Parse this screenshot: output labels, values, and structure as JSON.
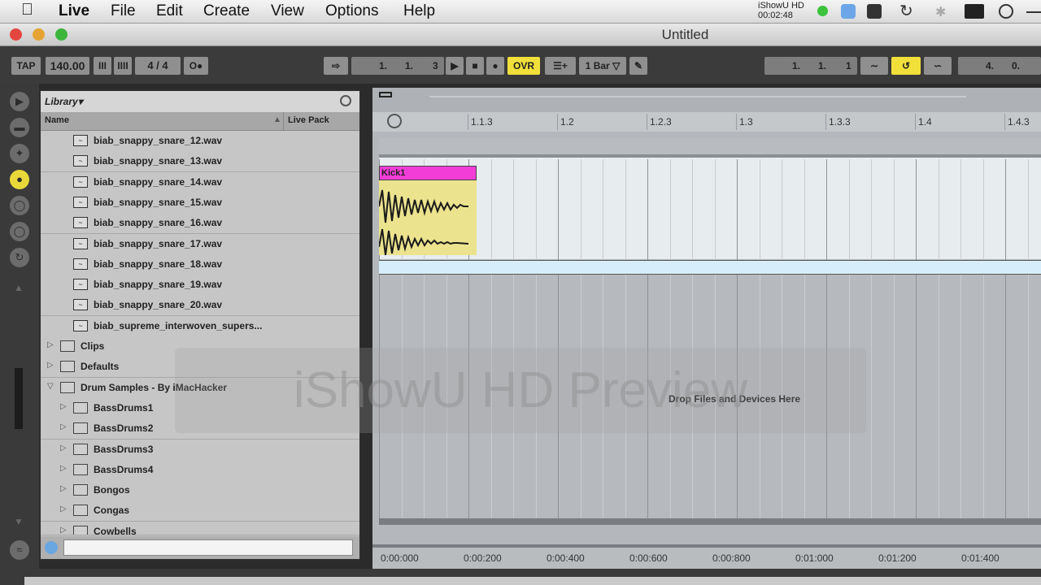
{
  "menubar": {
    "app": "Live",
    "items": [
      "File",
      "Edit",
      "Create",
      "View",
      "Options",
      "Help"
    ],
    "recorder_name": "iShowU HD",
    "recorder_time": "00:02:48"
  },
  "window": {
    "title": "Untitled"
  },
  "transport": {
    "tap": "TAP",
    "tempo": "140.00",
    "time_sig": "4 / 4",
    "position": [
      "1.",
      "1.",
      "3"
    ],
    "ovr": "OVR",
    "quantize": "1 Bar",
    "loop_start": [
      "1.",
      "1.",
      "1"
    ],
    "loop_length": [
      "4.",
      "0."
    ]
  },
  "browser": {
    "title": "Library",
    "col_name": "Name",
    "col_pack": "Live Pack",
    "files": [
      "biab_snappy_snare_12.wav",
      "biab_snappy_snare_13.wav",
      "biab_snappy_snare_14.wav",
      "biab_snappy_snare_15.wav",
      "biab_snappy_snare_16.wav",
      "biab_snappy_snare_17.wav",
      "biab_snappy_snare_18.wav",
      "biab_snappy_snare_19.wav",
      "biab_snappy_snare_20.wav",
      "biab_supreme_interwoven_supers..."
    ],
    "folders": [
      "Clips",
      "Defaults",
      "Drum Samples - By iMacHacker"
    ],
    "subfolders": [
      "BassDrums1",
      "BassDrums2",
      "BassDrums3",
      "BassDrums4",
      "Bongos",
      "Congas",
      "Cowbells"
    ]
  },
  "arrangement": {
    "beats": [
      "1.1.3",
      "1.2",
      "1.2.3",
      "1.3",
      "1.3.3",
      "1.4",
      "1.4.3"
    ],
    "clip_name": "Kick1",
    "drop_text": "Drop Files and Devices Here",
    "times": [
      "0:00:000",
      "0:00:200",
      "0:00:400",
      "0:00:600",
      "0:00:800",
      "0:01:000",
      "0:01:200",
      "0:01:400"
    ]
  },
  "watermark": "iShowU HD Preview",
  "colors": {
    "clip": "#f23dd7",
    "clip_body": "#ece38e",
    "highlight": "#f2e03a"
  }
}
